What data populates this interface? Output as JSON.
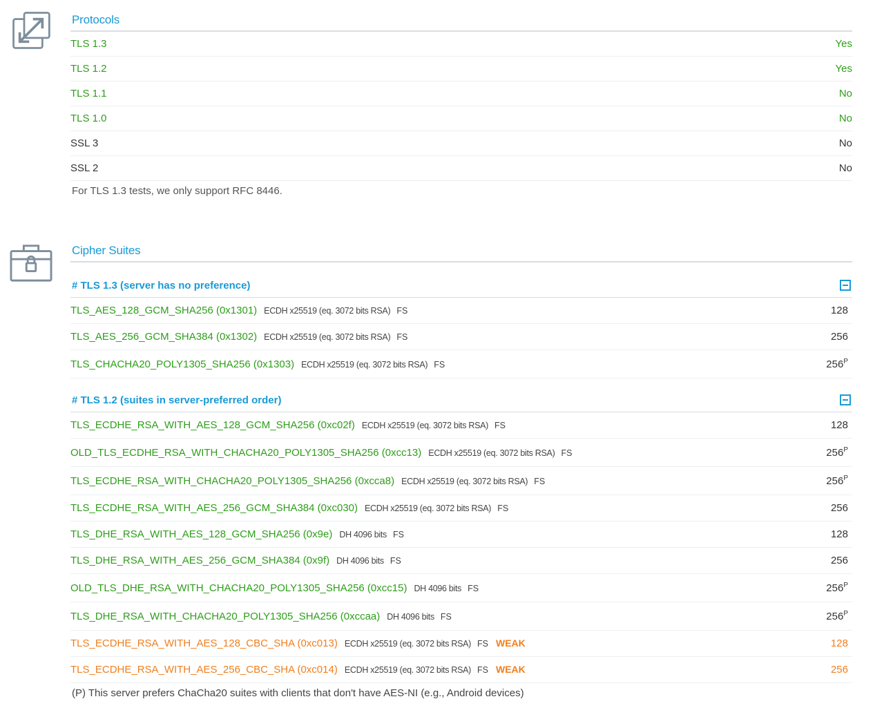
{
  "protocols": {
    "title": "Protocols",
    "rows": [
      {
        "name": "TLS 1.3",
        "value": "Yes",
        "color": "green"
      },
      {
        "name": "TLS 1.2",
        "value": "Yes",
        "color": "green"
      },
      {
        "name": "TLS 1.1",
        "value": "No",
        "color": "green"
      },
      {
        "name": "TLS 1.0",
        "value": "No",
        "color": "green"
      },
      {
        "name": "SSL 3",
        "value": "No",
        "color": "dark"
      },
      {
        "name": "SSL 2",
        "value": "No",
        "color": "dark"
      }
    ],
    "note": "For TLS 1.3 tests, we only support RFC 8446."
  },
  "ciphers": {
    "title": "Cipher Suites",
    "groups": [
      {
        "heading": "# TLS 1.3 (server has no preference)",
        "suites": [
          {
            "name": "TLS_AES_128_GCM_SHA256 (0x1301)",
            "kex": "ECDH x25519 (eq. 3072 bits RSA)",
            "fs": "FS",
            "weak": "",
            "bits": "128",
            "pref": ""
          },
          {
            "name": "TLS_AES_256_GCM_SHA384 (0x1302)",
            "kex": "ECDH x25519 (eq. 3072 bits RSA)",
            "fs": "FS",
            "weak": "",
            "bits": "256",
            "pref": ""
          },
          {
            "name": "TLS_CHACHA20_POLY1305_SHA256 (0x1303)",
            "kex": "ECDH x25519 (eq. 3072 bits RSA)",
            "fs": "FS",
            "weak": "",
            "bits": "256",
            "pref": "P"
          }
        ]
      },
      {
        "heading": "# TLS 1.2 (suites in server-preferred order)",
        "suites": [
          {
            "name": "TLS_ECDHE_RSA_WITH_AES_128_GCM_SHA256 (0xc02f)",
            "kex": "ECDH x25519 (eq. 3072 bits RSA)",
            "fs": "FS",
            "weak": "",
            "bits": "128",
            "pref": ""
          },
          {
            "name": "OLD_TLS_ECDHE_RSA_WITH_CHACHA20_POLY1305_SHA256 (0xcc13)",
            "kex": "ECDH x25519 (eq. 3072 bits RSA)",
            "fs": "FS",
            "weak": "",
            "bits": "256",
            "pref": "P"
          },
          {
            "name": "TLS_ECDHE_RSA_WITH_CHACHA20_POLY1305_SHA256 (0xcca8)",
            "kex": "ECDH x25519 (eq. 3072 bits RSA)",
            "fs": "FS",
            "weak": "",
            "bits": "256",
            "pref": "P"
          },
          {
            "name": "TLS_ECDHE_RSA_WITH_AES_256_GCM_SHA384 (0xc030)",
            "kex": "ECDH x25519 (eq. 3072 bits RSA)",
            "fs": "FS",
            "weak": "",
            "bits": "256",
            "pref": ""
          },
          {
            "name": "TLS_DHE_RSA_WITH_AES_128_GCM_SHA256 (0x9e)",
            "kex": "DH 4096 bits",
            "fs": "FS",
            "weak": "",
            "bits": "128",
            "pref": ""
          },
          {
            "name": "TLS_DHE_RSA_WITH_AES_256_GCM_SHA384 (0x9f)",
            "kex": "DH 4096 bits",
            "fs": "FS",
            "weak": "",
            "bits": "256",
            "pref": ""
          },
          {
            "name": "OLD_TLS_DHE_RSA_WITH_CHACHA20_POLY1305_SHA256 (0xcc15)",
            "kex": "DH 4096 bits",
            "fs": "FS",
            "weak": "",
            "bits": "256",
            "pref": "P"
          },
          {
            "name": "TLS_DHE_RSA_WITH_CHACHA20_POLY1305_SHA256 (0xccaa)",
            "kex": "DH 4096 bits",
            "fs": "FS",
            "weak": "",
            "bits": "256",
            "pref": "P"
          },
          {
            "name": "TLS_ECDHE_RSA_WITH_AES_128_CBC_SHA (0xc013)",
            "kex": "ECDH x25519 (eq. 3072 bits RSA)",
            "fs": "FS",
            "weak": "WEAK",
            "bits": "128",
            "pref": ""
          },
          {
            "name": "TLS_ECDHE_RSA_WITH_AES_256_CBC_SHA (0xc014)",
            "kex": "ECDH x25519 (eq. 3072 bits RSA)",
            "fs": "FS",
            "weak": "WEAK",
            "bits": "256",
            "pref": ""
          }
        ]
      }
    ],
    "footnote": "(P) This server prefers ChaCha20 suites with clients that don't have AES-NI (e.g., Android devices)"
  },
  "colors": {
    "accent": "#1a9ad6",
    "ok": "#2e9e1a",
    "warn": "#f07f1e"
  },
  "icons": {
    "protocols": "expand-arrows-icon",
    "ciphers": "locked-briefcase-icon"
  }
}
